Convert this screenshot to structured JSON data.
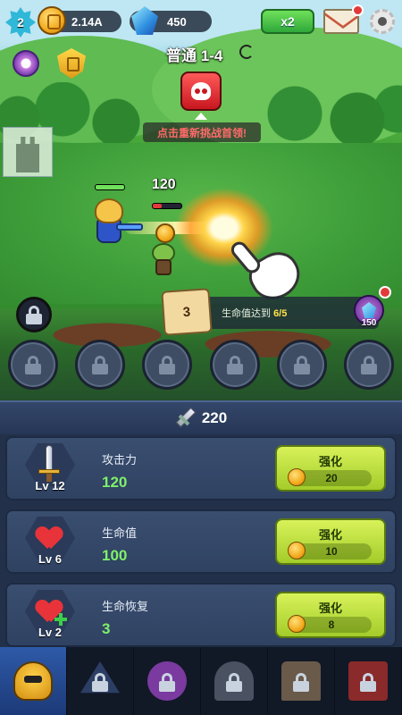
{
  "hud": {
    "player_level": "2",
    "gold": "2.14A",
    "gems": "450",
    "speed_label": "x2"
  },
  "stage": {
    "title": "普通 1-4",
    "boss_hint": "点击重新挑战首领!"
  },
  "battle": {
    "damage_number": "120",
    "hero_hp_fraction": 1.0,
    "enemy_hp_fraction": 0.3
  },
  "quest": {
    "index": "3",
    "text_prefix": "生命值达到 ",
    "progress": "6/5",
    "reward_count": "150"
  },
  "power": {
    "value": "220"
  },
  "upgrades": [
    {
      "name": "攻击力",
      "level": "Lv 12",
      "value": "120",
      "button_label": "强化",
      "cost": "20",
      "icon": "sword-icon"
    },
    {
      "name": "生命值",
      "level": "Lv 6",
      "value": "100",
      "button_label": "强化",
      "cost": "10",
      "icon": "heart-icon"
    },
    {
      "name": "生命恢复",
      "level": "Lv 2",
      "value": "3",
      "button_label": "强化",
      "cost": "8",
      "icon": "heart-plus-icon"
    }
  ],
  "tabs": [
    {
      "id": "hero",
      "icon": "spartan-helmet-icon",
      "locked": false,
      "active": true
    },
    {
      "id": "rune",
      "icon": "star-rune-icon",
      "locked": true
    },
    {
      "id": "beast",
      "icon": "beast-icon",
      "locked": true
    },
    {
      "id": "gate",
      "icon": "gate-icon",
      "locked": true
    },
    {
      "id": "tower",
      "icon": "tower-icon",
      "locked": true
    },
    {
      "id": "shop",
      "icon": "shop-icon",
      "locked": true
    }
  ],
  "colors": {
    "panel_bg": "#223149",
    "stat_value_green": "#7ef06a",
    "upgrade_button": "#c5e33f",
    "boss_red": "#e0222a",
    "hint_red": "#ff6a6a"
  }
}
